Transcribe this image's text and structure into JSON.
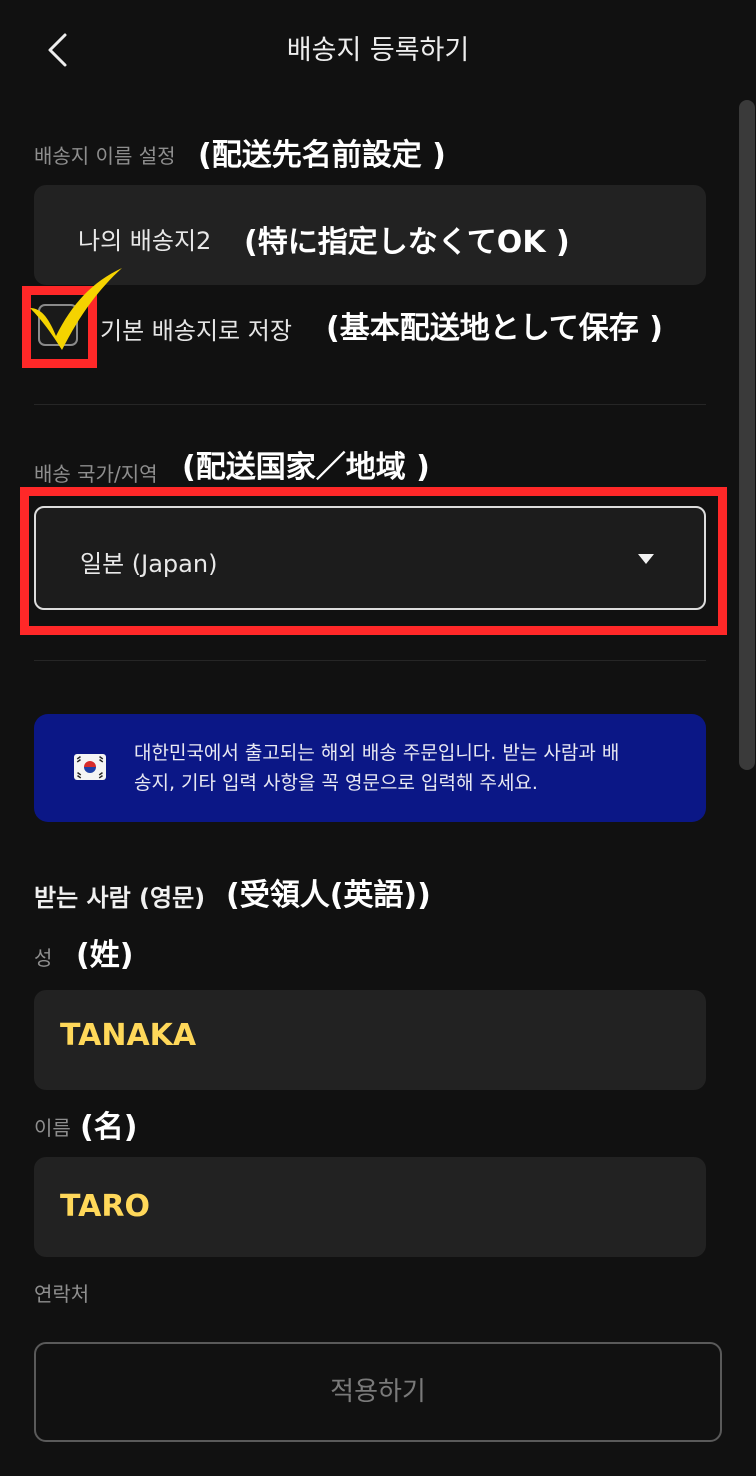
{
  "header": {
    "title": "배송지 등록하기"
  },
  "name_section": {
    "label": "배송지 이름 설정",
    "annotation": "(配送先名前設定 )",
    "value": "나의 배송지2",
    "value_annotation": "(特に指定しなくてOK )"
  },
  "default_checkbox": {
    "label": "기본 배송지로 저장",
    "annotation": "(基本配送地として保存 )",
    "checked": true
  },
  "country_section": {
    "label": "배송 국가/지역",
    "annotation": "(配送国家／地域 )",
    "selected": "일본 (Japan)"
  },
  "notice": {
    "text_line1": "대한민국에서 출고되는 해외 배송 주문입니다. 받는 사람과 배",
    "text_line2": "송지, 기타 입력 사항을 꼭 영문으로 입력해 주세요."
  },
  "recipient": {
    "title": "받는 사람 (영문)",
    "title_annotation": "(受領人(英語))",
    "last_name_label": "성",
    "last_name_annotation": "(姓)",
    "last_name_value": "TANAKA",
    "first_name_label": "이름",
    "first_name_annotation": "(名)",
    "first_name_value": "TARO",
    "contact_label": "연락처"
  },
  "apply_button": {
    "label": "적용하기"
  },
  "colors": {
    "background": "#111111",
    "field": "#222222",
    "annotation_red": "#ff2828",
    "check_yellow": "#f5d300",
    "typed_yellow": "#ffd85a",
    "notice_blue": "#0b1786"
  }
}
